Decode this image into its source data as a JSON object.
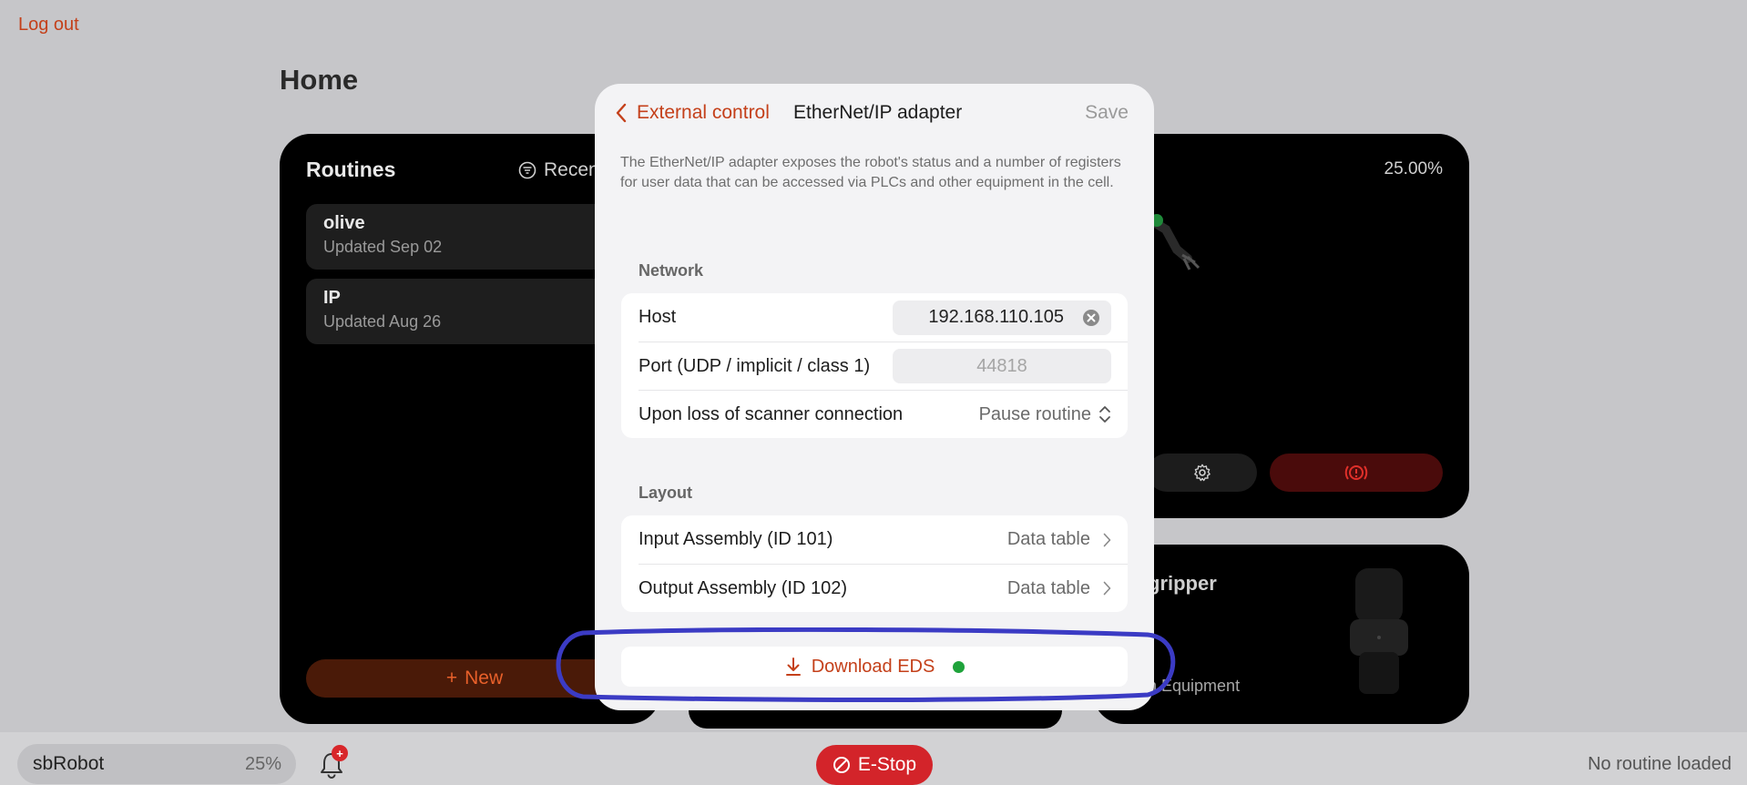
{
  "app": {
    "logout_label": "Log out",
    "page_title": "Home"
  },
  "routines": {
    "title": "Routines",
    "sort_label": "Recen",
    "items": [
      {
        "name": "olive",
        "date": "Updated Sep 02"
      },
      {
        "name": "IP",
        "date": "Updated Aug 26"
      }
    ],
    "new_label": "New"
  },
  "robot_card": {
    "speed_pct": "25.00%"
  },
  "gripper_card": {
    "title": "gripper",
    "subtitle": "n Equipment"
  },
  "bottom_bar": {
    "robot_name": "sbRobot",
    "robot_pct": "25%",
    "notification_badge": "+",
    "estop_label": "E-Stop",
    "status": "No routine loaded"
  },
  "modal": {
    "back_label": "External control",
    "title": "EtherNet/IP adapter",
    "save_label": "Save",
    "description": "The EtherNet/IP adapter exposes the robot's status and a number of registers for user data that can be accessed via PLCs and other equipment in the cell.",
    "network": {
      "section_label": "Network",
      "host_label": "Host",
      "host_value": "192.168.110.105",
      "port_label": "Port (UDP / implicit / class 1)",
      "port_placeholder": "44818",
      "loss_label": "Upon loss of scanner connection",
      "loss_value": "Pause routine"
    },
    "layout": {
      "section_label": "Layout",
      "input_label": "Input Assembly (ID 101)",
      "input_value": "Data table",
      "output_label": "Output Assembly (ID 102)",
      "output_value": "Data table"
    },
    "download_label": "Download EDS"
  },
  "colors": {
    "accent": "#c4401a",
    "estop": "#d3242a",
    "status_dot": "#1fa33b",
    "highlight": "#3b3bc4"
  }
}
